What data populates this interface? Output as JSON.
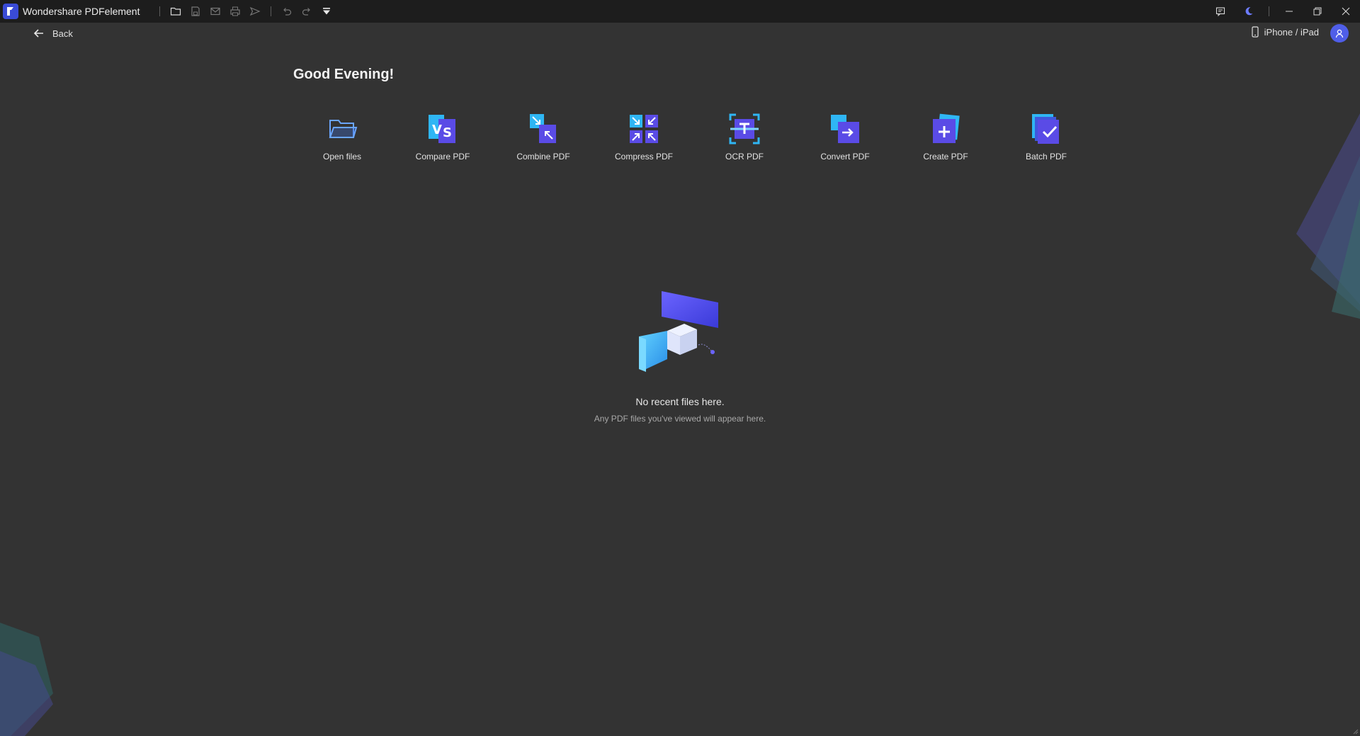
{
  "app": {
    "title": "Wondershare PDFelement",
    "accent_color": "#4f5ee8"
  },
  "toolbar": {
    "icons": [
      "open-folder-icon",
      "save-icon",
      "mail-icon",
      "print-icon",
      "share-icon",
      "undo-icon",
      "redo-icon",
      "customize-icon"
    ]
  },
  "header": {
    "back_label": "Back",
    "device_label": "iPhone / iPad"
  },
  "greeting": "Good Evening!",
  "tools": [
    {
      "label": "Open files",
      "icon": "open-folder-icon"
    },
    {
      "label": "Compare PDF",
      "icon": "compare-icon"
    },
    {
      "label": "Combine PDF",
      "icon": "combine-icon"
    },
    {
      "label": "Compress PDF",
      "icon": "compress-icon"
    },
    {
      "label": "OCR PDF",
      "icon": "ocr-icon"
    },
    {
      "label": "Convert PDF",
      "icon": "convert-icon"
    },
    {
      "label": "Create PDF",
      "icon": "create-icon"
    },
    {
      "label": "Batch PDF",
      "icon": "batch-icon"
    }
  ],
  "empty_state": {
    "title": "No recent files here.",
    "subtitle": "Any PDF files you've viewed will appear here."
  }
}
